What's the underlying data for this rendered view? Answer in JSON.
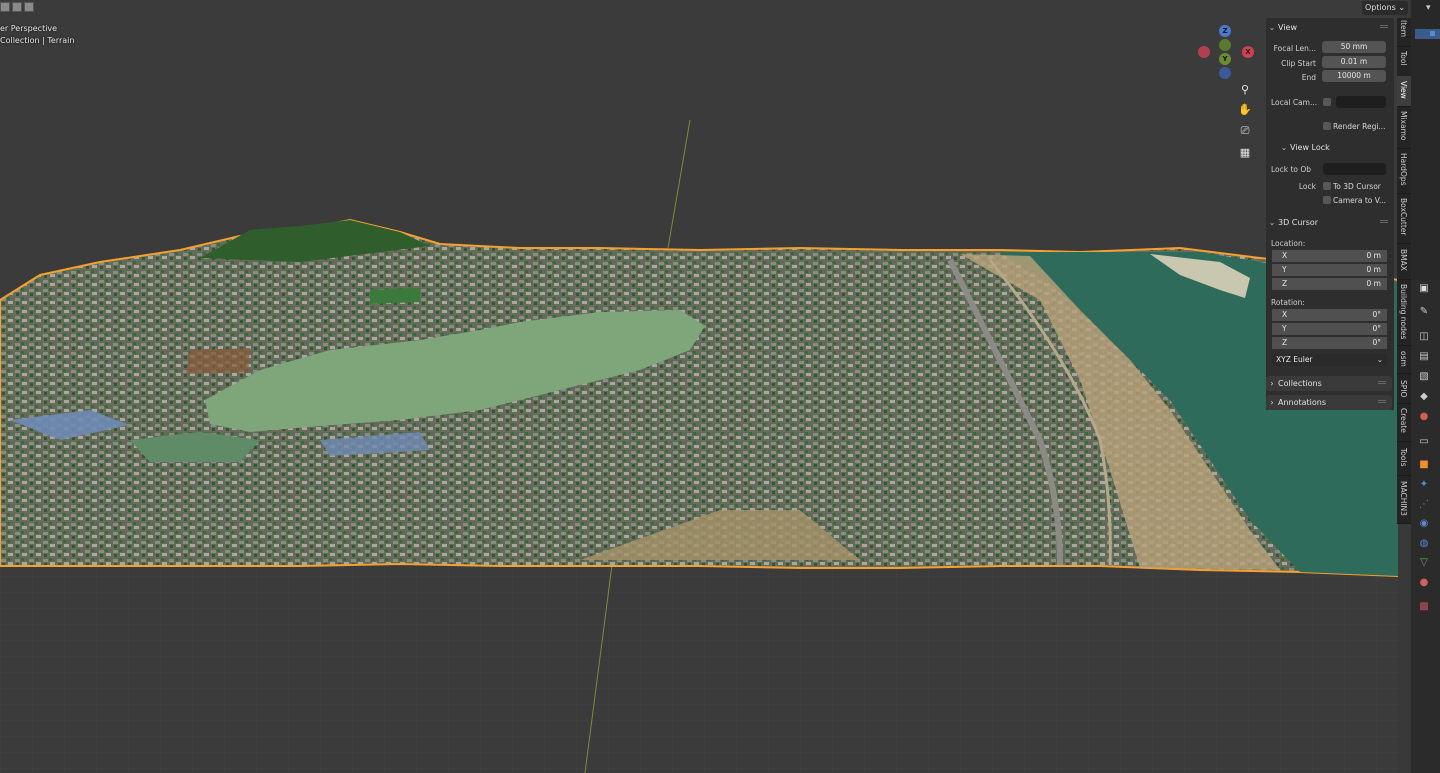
{
  "viewport": {
    "perspective_label": "er Perspective",
    "collection_label": "Collection | Terrain",
    "options_label": "Options",
    "gizmo": {
      "z": "Z",
      "y": "Y",
      "x": "X"
    }
  },
  "npanel": {
    "view": {
      "title": "View",
      "focal_label": "Focal Len...",
      "focal_value": "50 mm",
      "clip_start_label": "Clip Start",
      "clip_start_value": "0.01 m",
      "end_label": "End",
      "end_value": "10000 m",
      "local_cam_label": "Local Cam...",
      "render_region_label": "Render Regi..."
    },
    "view_lock": {
      "title": "View Lock",
      "lock_to_ob_label": "Lock to Ob",
      "lock_label": "Lock",
      "to_3d_cursor_label": "To 3D Cursor",
      "camera_to_view_label": "Camera to V..."
    },
    "cursor": {
      "title": "3D Cursor",
      "location_label": "Location:",
      "location": [
        {
          "axis": "X",
          "value": "0 m"
        },
        {
          "axis": "Y",
          "value": "0 m"
        },
        {
          "axis": "Z",
          "value": "0 m"
        }
      ],
      "rotation_label": "Rotation:",
      "rotation": [
        {
          "axis": "X",
          "value": "0°"
        },
        {
          "axis": "Y",
          "value": "0°"
        },
        {
          "axis": "Z",
          "value": "0°"
        }
      ],
      "rotation_mode": "XYZ Euler"
    },
    "collections_title": "Collections",
    "annotations_title": "Annotations"
  },
  "tabs": [
    "Item",
    "Tool",
    "View",
    "Mixamo",
    "HardOps",
    "BoxCutter",
    "BMAX",
    "Building nodes",
    "osm",
    "SPIO",
    "Create",
    "Tools",
    "MACHIN3"
  ],
  "active_tab": "View",
  "colors": {
    "selection_outline": "#f5a030",
    "panel_bg": "#2e2e2e",
    "field_bg": "#545454",
    "accent_blue": "#3b5b8a"
  }
}
